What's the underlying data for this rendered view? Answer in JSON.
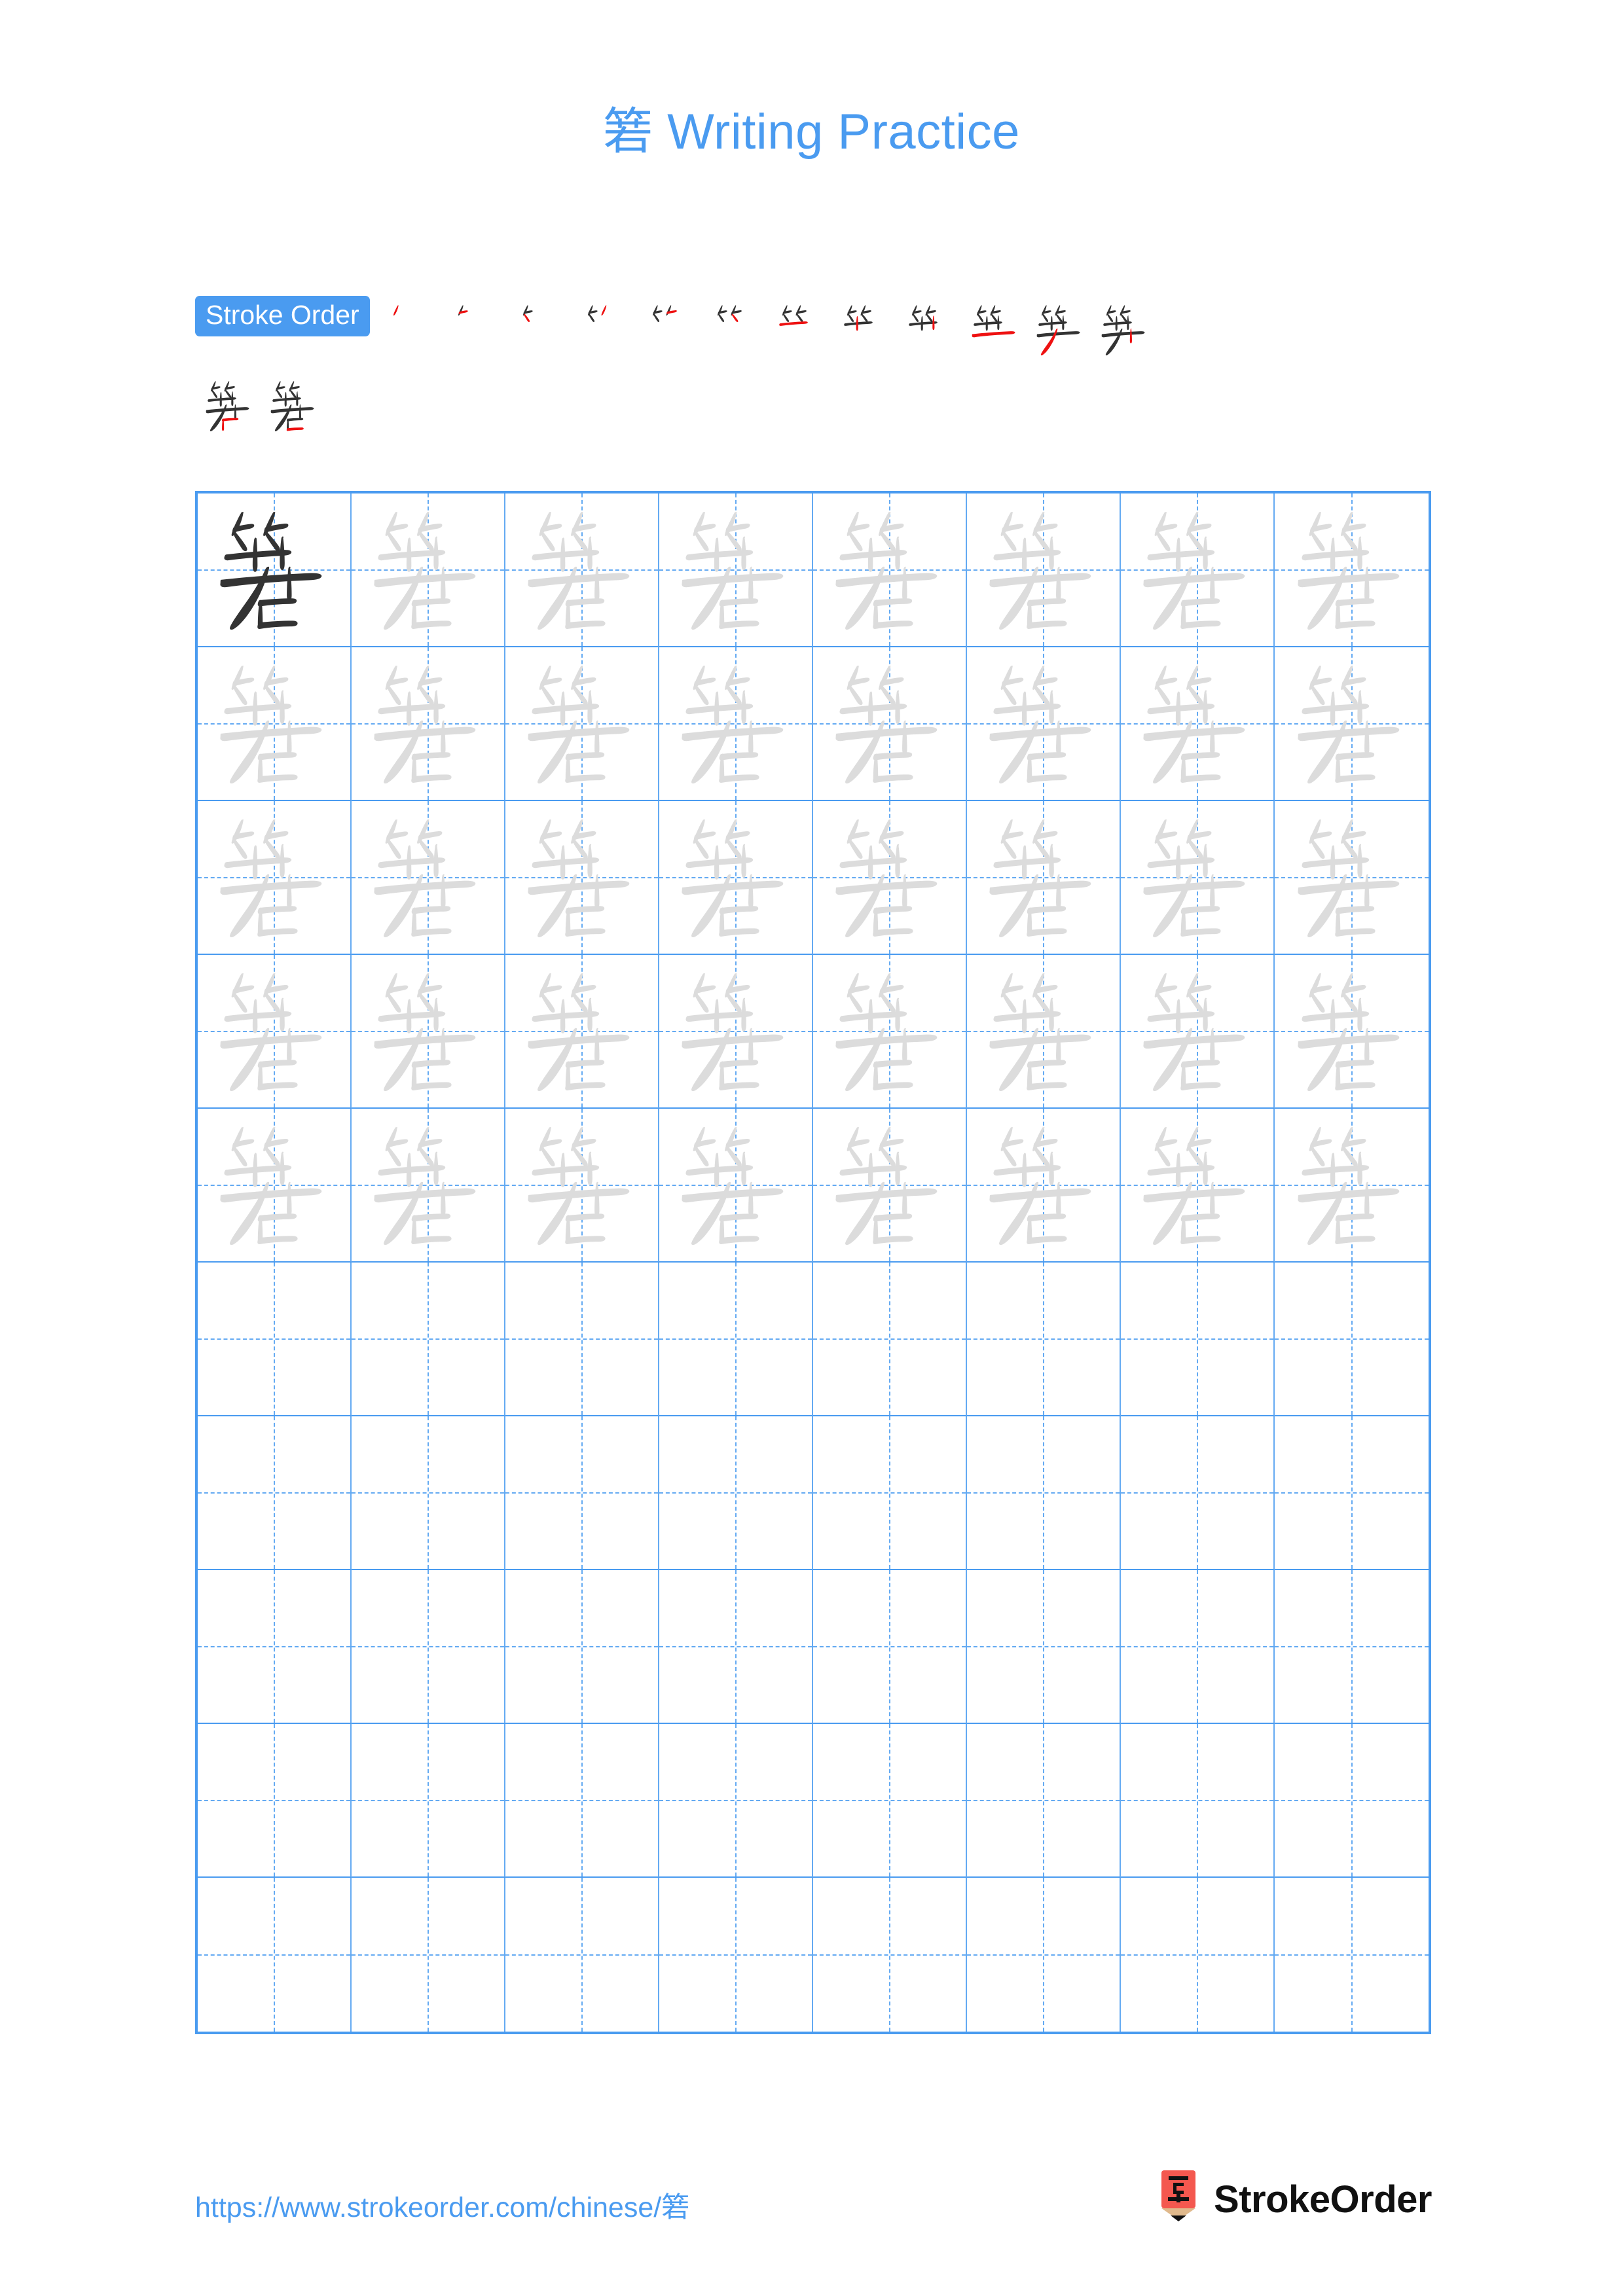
{
  "page": {
    "character": "箬",
    "title": "箬 Writing Practice",
    "background_color": "#ffffff",
    "accent_color": "#4a9bf0",
    "grid_line_color": "#64aaf2",
    "dark_glyph_color": "#333333",
    "light_glyph_color": "#dcdcdc",
    "new_stroke_color": "#ee1111"
  },
  "stroke_order": {
    "label": "Stroke Order",
    "total_strokes": 14,
    "steps": [
      {
        "index": 1,
        "strokes_shown": 1,
        "new_stroke_color": "#ee1111"
      },
      {
        "index": 2,
        "strokes_shown": 2,
        "new_stroke_color": "#ee1111"
      },
      {
        "index": 3,
        "strokes_shown": 3,
        "new_stroke_color": "#ee1111"
      },
      {
        "index": 4,
        "strokes_shown": 4,
        "new_stroke_color": "#ee1111"
      },
      {
        "index": 5,
        "strokes_shown": 5,
        "new_stroke_color": "#ee1111"
      },
      {
        "index": 6,
        "strokes_shown": 6,
        "new_stroke_color": "#ee1111"
      },
      {
        "index": 7,
        "strokes_shown": 7,
        "new_stroke_color": "#ee1111"
      },
      {
        "index": 8,
        "strokes_shown": 8,
        "new_stroke_color": "#ee1111"
      },
      {
        "index": 9,
        "strokes_shown": 9,
        "new_stroke_color": "#ee1111"
      },
      {
        "index": 10,
        "strokes_shown": 10,
        "new_stroke_color": "#ee1111"
      },
      {
        "index": 11,
        "strokes_shown": 11,
        "new_stroke_color": "#ee1111"
      },
      {
        "index": 12,
        "strokes_shown": 12,
        "new_stroke_color": "#ee1111"
      },
      {
        "index": 13,
        "strokes_shown": 13,
        "new_stroke_color": "#ee1111"
      },
      {
        "index": 14,
        "strokes_shown": 14,
        "new_stroke_color": "#ee1111"
      }
    ],
    "row_breaks": [
      12
    ]
  },
  "practice_grid": {
    "columns": 8,
    "rows": 10,
    "filled_rows": 5,
    "empty_rows": 5,
    "rows_data": [
      [
        "dark",
        "light",
        "light",
        "light",
        "light",
        "light",
        "light",
        "light"
      ],
      [
        "light",
        "light",
        "light",
        "light",
        "light",
        "light",
        "light",
        "light"
      ],
      [
        "light",
        "light",
        "light",
        "light",
        "light",
        "light",
        "light",
        "light"
      ],
      [
        "light",
        "light",
        "light",
        "light",
        "light",
        "light",
        "light",
        "light"
      ],
      [
        "light",
        "light",
        "light",
        "light",
        "light",
        "light",
        "light",
        "light"
      ],
      [
        "empty",
        "empty",
        "empty",
        "empty",
        "empty",
        "empty",
        "empty",
        "empty"
      ],
      [
        "empty",
        "empty",
        "empty",
        "empty",
        "empty",
        "empty",
        "empty",
        "empty"
      ],
      [
        "empty",
        "empty",
        "empty",
        "empty",
        "empty",
        "empty",
        "empty",
        "empty"
      ],
      [
        "empty",
        "empty",
        "empty",
        "empty",
        "empty",
        "empty",
        "empty",
        "empty"
      ],
      [
        "empty",
        "empty",
        "empty",
        "empty",
        "empty",
        "empty",
        "empty",
        "empty"
      ]
    ]
  },
  "footer": {
    "url": "https://www.strokeorder.com/chinese/箬",
    "brand_name": "StrokeOrder",
    "logo_character": "字",
    "logo_body_color": "#f4584f",
    "logo_wood_color": "#e0b98c",
    "logo_tip_color": "#111111"
  }
}
